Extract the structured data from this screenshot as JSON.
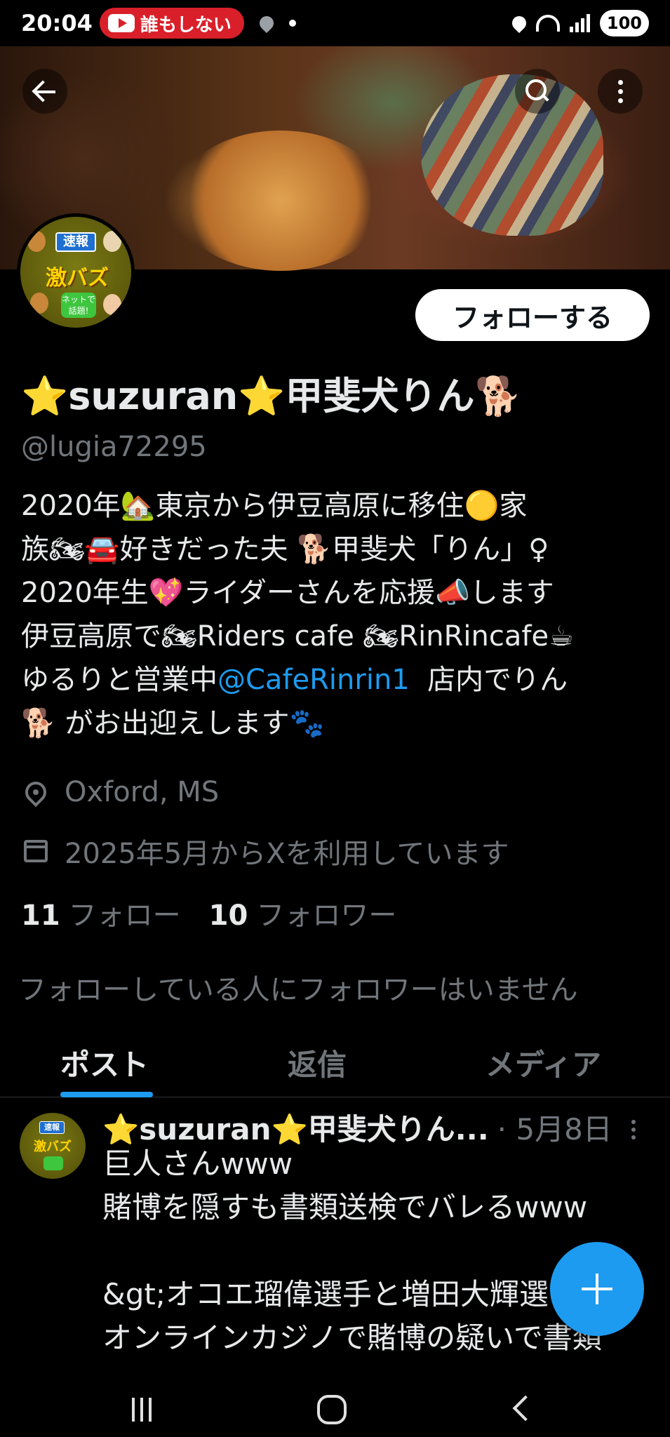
{
  "status_bar": {
    "time": "20:04",
    "notification_text": "誰もしない",
    "battery": "100"
  },
  "profile": {
    "display_name": "⭐suzuran⭐甲斐犬りん🐕",
    "handle": "@lugia72295",
    "follow_label": "フォローする",
    "avatar_badge": "速報",
    "avatar_title": "激バズ",
    "avatar_bubble": "ネットで話題!",
    "bio_before_mention": "2020年🏡東京から伊豆高原に移住🟡家\n族🏍🚘好きだった夫 🐕甲斐犬「りん」♀\n2020年生💖ライダーさんを応援📣します\n伊豆高原で🏍Riders cafe 🏍RinRincafe☕\nゆるりと営業中",
    "bio_mention": "@CafeRinrin1",
    "bio_after_mention": "  店内でりん\n🐕 がお出迎えします🐾",
    "location": "Oxford, MS",
    "joined": "2025年5月からXを利用しています",
    "following_count": "11",
    "following_label": "フォロー",
    "followers_count": "10",
    "followers_label": "フォロワー",
    "mutual_note": "フォローしている人にフォロワーはいません"
  },
  "tabs": [
    {
      "label": "ポスト",
      "active": true
    },
    {
      "label": "返信",
      "active": false
    },
    {
      "label": "メディア",
      "active": false
    }
  ],
  "post": {
    "author": "⭐suzuran⭐甲斐犬りん...",
    "date": "· 5月8日",
    "text": "巨人さんwww\n賭博を隠すも書類送検でバレるwww\n\n&gt;オコエ瑠偉選手と増田大輝選\nオンラインカジノで賭博の疑いで書類"
  },
  "icons": {
    "back": "arrow-left-icon",
    "search": "search-icon",
    "more": "more-vertical-icon",
    "location": "location-pin-icon",
    "calendar": "calendar-icon",
    "compose": "plus-icon"
  },
  "colors": {
    "accent": "#1d9bf0",
    "background": "#000000",
    "text": "#e7e9ea",
    "secondary_text": "#71767b"
  }
}
